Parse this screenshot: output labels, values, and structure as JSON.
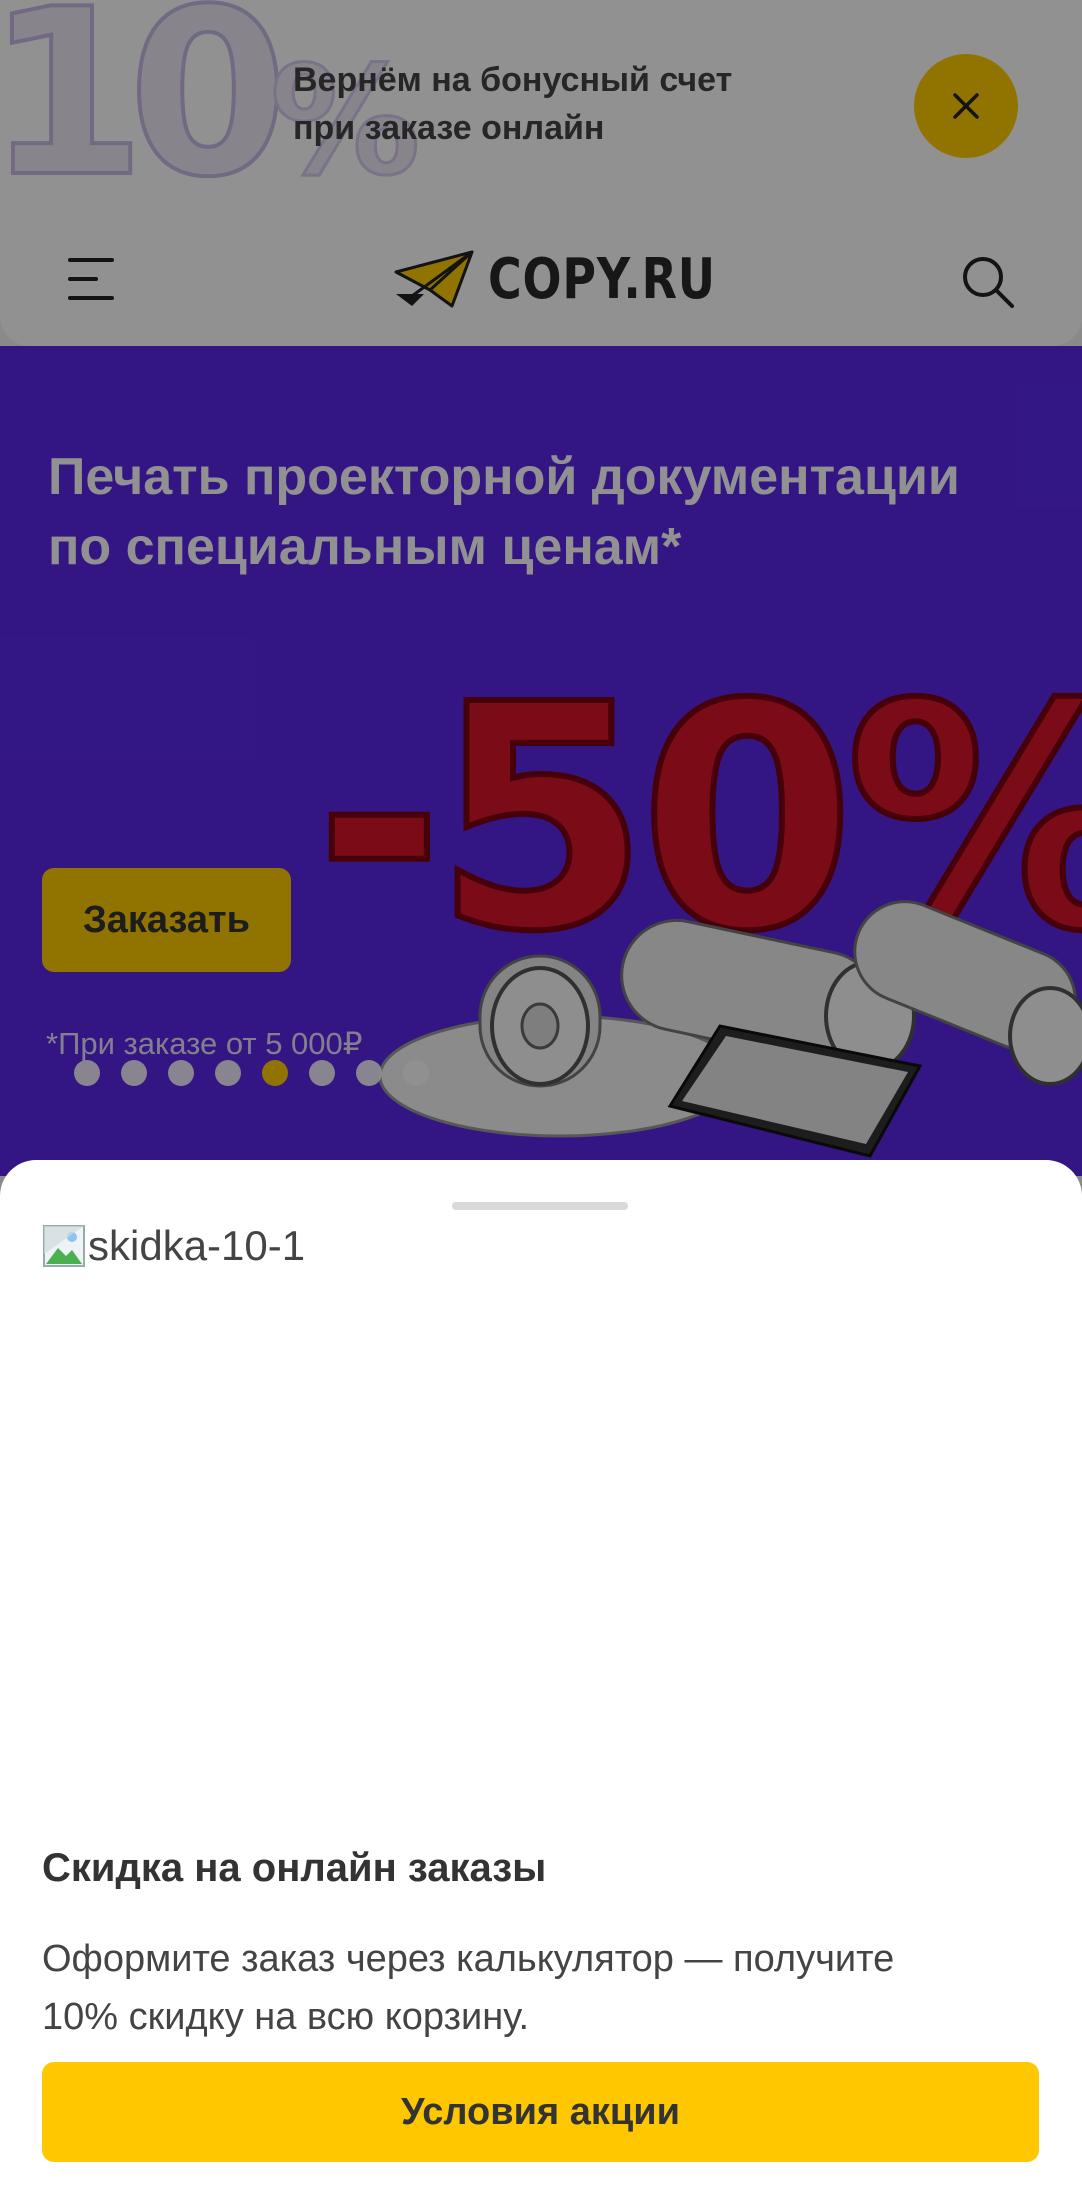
{
  "promo": {
    "graphic_text": "10",
    "graphic_percent": "%",
    "line1": "Вернём на бонусный счет",
    "line2": "при заказе онлайн",
    "close_icon": "close-icon",
    "accent": "#ffcd00"
  },
  "header": {
    "menu_icon": "hamburger-menu-icon",
    "logo_text": "COPY.RU",
    "search_icon": "search-icon"
  },
  "hero": {
    "title_line1": "Печать проекторной документации",
    "title_line2": "по специальным ценам*",
    "graphic_text": "-50%",
    "order_button": "Заказать",
    "note": "*При заказе от 5 000₽",
    "background": "#5a28e8",
    "slides_total": 8,
    "active_slide": 5
  },
  "sheet": {
    "image_alt": "skidka-10-1",
    "title": "Скидка на онлайн заказы",
    "text_line1": "Оформите заказ через калькулятор — получите",
    "text_line2": "10% скидку на всю корзину.",
    "terms_button": "Условия акции",
    "button_color": "#ffc700"
  }
}
